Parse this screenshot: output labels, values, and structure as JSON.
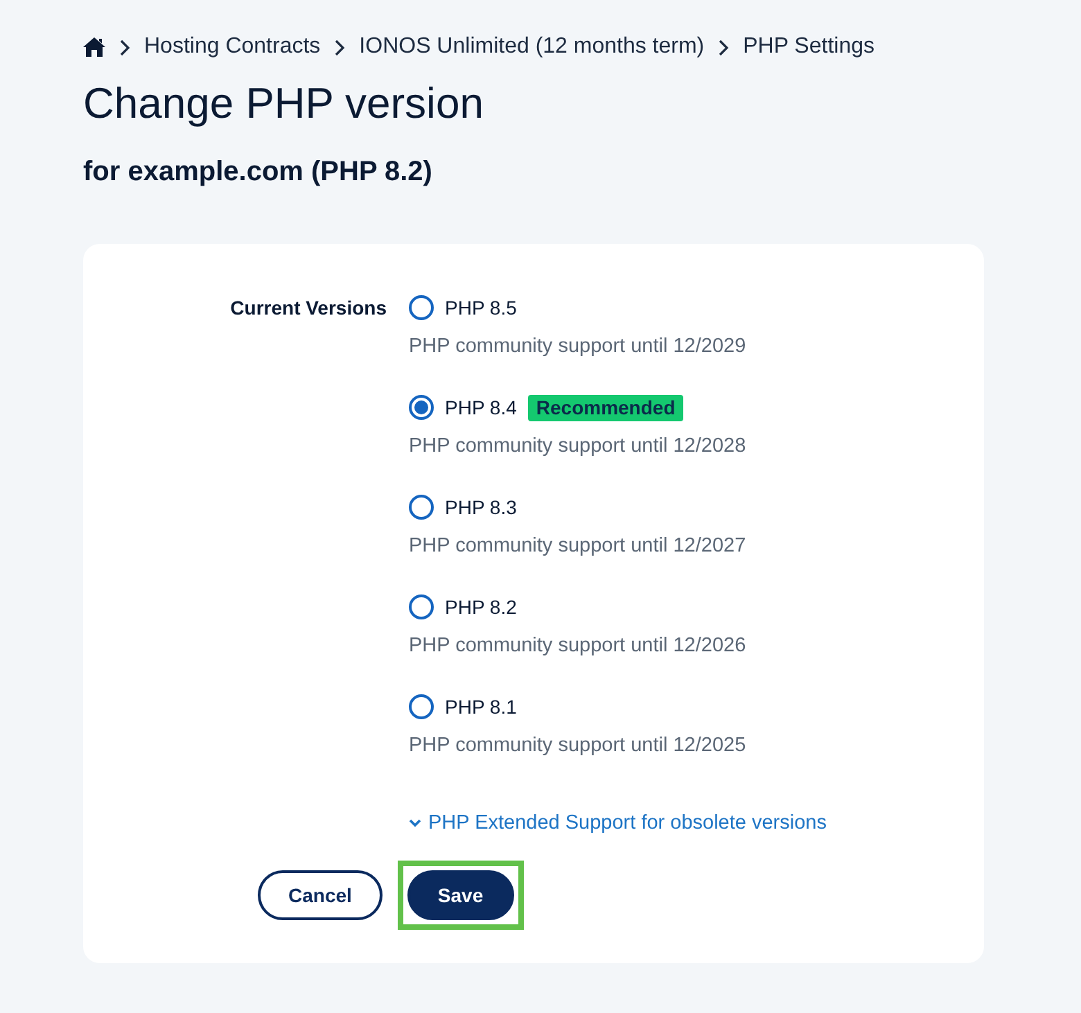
{
  "breadcrumb": {
    "items": [
      {
        "label": "Hosting Contracts"
      },
      {
        "label": "IONOS Unlimited (12 months term)"
      },
      {
        "label": "PHP Settings"
      }
    ]
  },
  "title": "Change PHP version",
  "subtitle": "for example.com (PHP 8.2)",
  "form": {
    "label": "Current Versions",
    "options": [
      {
        "label": "PHP 8.5",
        "selected": false,
        "description": "PHP community support until 12/2029"
      },
      {
        "label": "PHP 8.4",
        "selected": true,
        "badge": "Recommended",
        "description": "PHP community support until 12/2028"
      },
      {
        "label": "PHP 8.3",
        "selected": false,
        "description": "PHP community support until 12/2027"
      },
      {
        "label": "PHP 8.2",
        "selected": false,
        "description": "PHP community support until 12/2026"
      },
      {
        "label": "PHP 8.1",
        "selected": false,
        "description": "PHP community support until 12/2025"
      }
    ],
    "extended_link": {
      "label": "PHP Extended Support for obsolete versions",
      "expanded": false
    },
    "buttons": [
      {
        "kind": "secondary",
        "label": "Cancel",
        "highlighted": false
      },
      {
        "kind": "primary",
        "label": "Save",
        "highlighted": true
      }
    ]
  }
}
